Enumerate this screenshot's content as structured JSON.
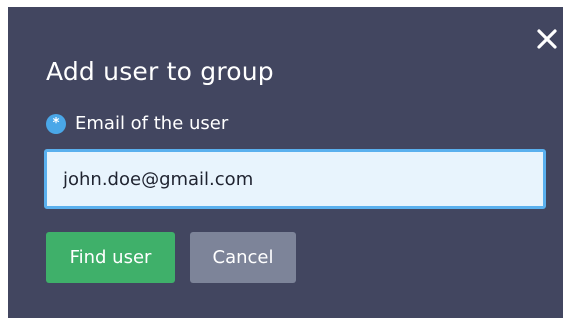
{
  "dialog": {
    "title": "Add user to group",
    "close_icon": "close-icon"
  },
  "email_field": {
    "required_marker": "*",
    "label": "Email of the user",
    "value": "john.doe@gmail.com",
    "placeholder": ""
  },
  "actions": {
    "find_label": "Find user",
    "cancel_label": "Cancel"
  },
  "colors": {
    "dialog_bg": "#424660",
    "accent": "#4aa7e8",
    "input_bg": "#e8f4fd",
    "primary_button": "#3fb06a",
    "secondary_button": "#7d8499"
  }
}
